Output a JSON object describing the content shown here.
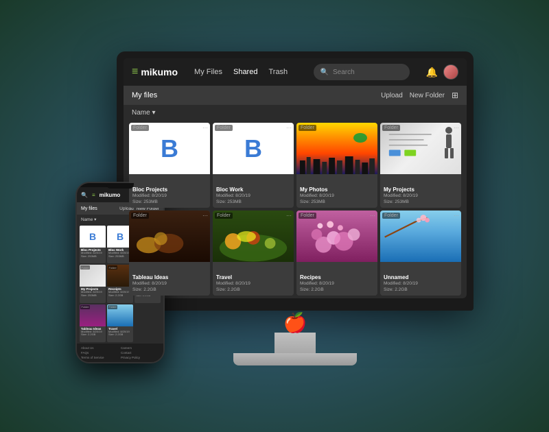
{
  "app": {
    "logo_icon": "≡",
    "logo_text": "mikumo",
    "nav": {
      "items": [
        {
          "label": "My Files",
          "active": false
        },
        {
          "label": "Shared",
          "active": true
        },
        {
          "label": "Trash",
          "active": false
        }
      ]
    },
    "search_placeholder": "Search",
    "bell_icon": "🔔",
    "toolbar": {
      "breadcrumb": "My files",
      "upload_label": "Upload",
      "new_folder_label": "New Folder",
      "sort_label": "Name ▾"
    },
    "files": [
      {
        "name": "Bloc Projects",
        "type": "Folder",
        "modified": "8/20/19",
        "size": "253MB",
        "style": "folder-b",
        "letter": "B"
      },
      {
        "name": "Bloc Work",
        "type": "Folder",
        "modified": "8/20/19",
        "size": "253MB",
        "style": "folder-b",
        "letter": "B"
      },
      {
        "name": "My Photos",
        "type": "Folder",
        "modified": "8/20/19",
        "size": "253MB",
        "style": "photo-city"
      },
      {
        "name": "My Projects",
        "type": "Folder",
        "modified": "8/20/19",
        "size": "253MB",
        "style": "photo-whiteboard"
      },
      {
        "name": "Tableau Ideas",
        "type": "Folder",
        "modified": "8/20/19",
        "size": "2.2GB",
        "style": "photo-food-dark"
      },
      {
        "name": "Travel",
        "type": "Folder",
        "modified": "8/20/19",
        "size": "2.2GB",
        "style": "photo-salad"
      },
      {
        "name": "Recipes",
        "type": "Folder",
        "modified": "8/20/19",
        "size": "2.2GB",
        "style": "photo-flowers"
      },
      {
        "name": "Unnamed",
        "type": "Folder",
        "modified": "8/20/19",
        "size": "2.2GB",
        "style": "photo-blue"
      }
    ],
    "footer": {
      "links": [
        "About Us",
        "FAQs",
        "Terms of Service",
        "Careers",
        "Contact",
        "Privacy Policy"
      ]
    }
  }
}
